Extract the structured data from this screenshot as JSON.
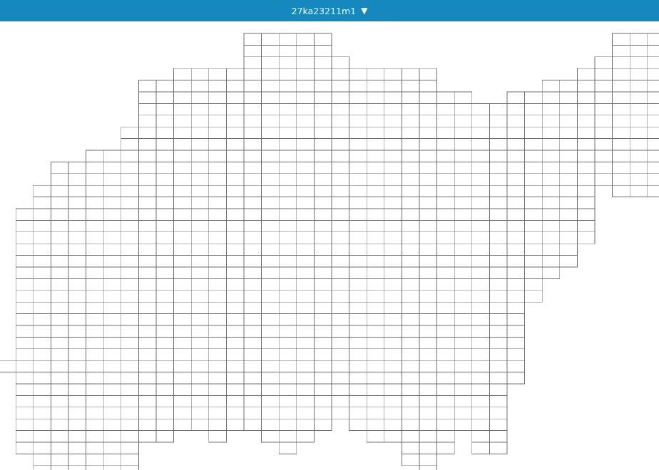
{
  "header": {
    "dataset_label": "27ka23211m1",
    "dropdown_icon": "caret-down-icon",
    "background_color": "#1589bd",
    "text_color": "#ffffff"
  },
  "grid": {
    "cell_fill": "#ffffff",
    "cell_stroke": "#6e6e6e",
    "column_count": 38,
    "row_count": 38,
    "column_extents": [
      [
        28,
        28
      ],
      [
        15,
        35
      ],
      [
        13,
        37
      ],
      [
        11,
        38
      ],
      [
        11,
        38
      ],
      [
        10,
        37
      ],
      [
        10,
        37
      ],
      [
        8,
        37
      ],
      [
        4,
        34
      ],
      [
        4,
        34
      ],
      [
        3,
        33
      ],
      [
        3,
        33
      ],
      [
        3,
        34
      ],
      [
        3,
        33
      ],
      [
        0,
        33
      ],
      [
        0,
        34
      ],
      [
        0,
        35
      ],
      [
        0,
        34
      ],
      [
        0,
        33
      ],
      [
        2,
        32
      ],
      [
        3,
        33
      ],
      [
        3,
        34
      ],
      [
        3,
        34
      ],
      [
        3,
        36
      ],
      [
        3,
        37
      ],
      [
        5,
        35
      ],
      [
        5,
        33
      ],
      [
        6,
        35
      ],
      [
        6,
        35
      ],
      [
        5,
        29
      ],
      [
        5,
        22
      ],
      [
        4,
        20
      ],
      [
        4,
        19
      ],
      [
        3,
        17
      ],
      [
        2,
        12
      ],
      [
        0,
        13
      ],
      [
        0,
        13
      ],
      [
        0,
        13
      ]
    ]
  }
}
